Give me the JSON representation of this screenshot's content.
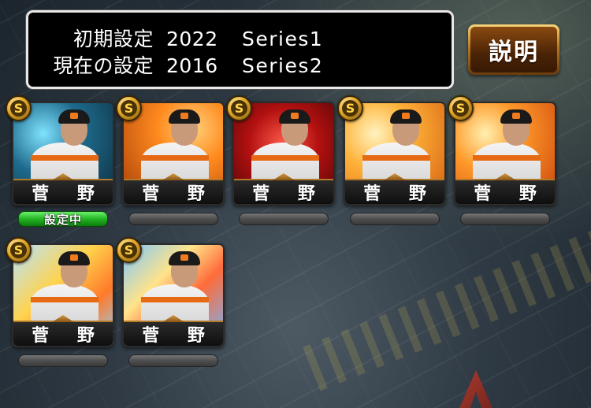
{
  "info": {
    "initial": {
      "label": "初期設定",
      "year": "2022",
      "series": "Series1"
    },
    "current": {
      "label": "現在の設定",
      "year": "2016",
      "series": "Series2"
    }
  },
  "explain_button": {
    "label": "説明"
  },
  "badge_letter": "S",
  "cards": [
    {
      "name": "菅 野",
      "status": "設定中"
    },
    {
      "name": "菅 野",
      "status": ""
    },
    {
      "name": "菅 野",
      "status": ""
    },
    {
      "name": "菅 野",
      "status": ""
    },
    {
      "name": "菅 野",
      "status": ""
    },
    {
      "name": "菅 野",
      "status": ""
    },
    {
      "name": "菅 野",
      "status": ""
    }
  ]
}
